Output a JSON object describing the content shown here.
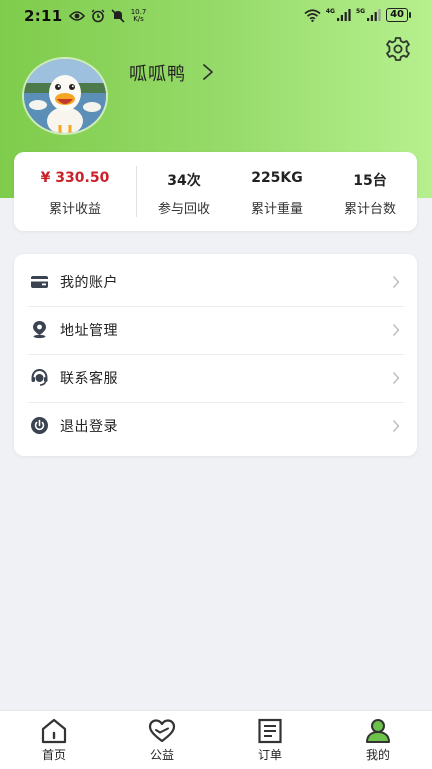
{
  "status_bar": {
    "time": "2:11",
    "speed_value": "10.7",
    "speed_unit": "K/s",
    "net_label": "4G",
    "net_label_2": "5G",
    "battery": "40"
  },
  "profile": {
    "name": "呱呱鸭"
  },
  "stats": [
    {
      "value": "¥ 330.50",
      "label": "累计收益"
    },
    {
      "value": "34次",
      "label": "参与回收"
    },
    {
      "value": "225KG",
      "label": "累计重量"
    },
    {
      "value": "15台",
      "label": "累计台数"
    }
  ],
  "menu": [
    {
      "label": "我的账户",
      "icon": "wallet-icon"
    },
    {
      "label": "地址管理",
      "icon": "location-pin-icon"
    },
    {
      "label": "联系客服",
      "icon": "headset-icon"
    },
    {
      "label": "退出登录",
      "icon": "power-icon"
    }
  ],
  "tabs": [
    {
      "label": "首页",
      "icon": "home-icon"
    },
    {
      "label": "公益",
      "icon": "heart-icon"
    },
    {
      "label": "订单",
      "icon": "order-list-icon"
    },
    {
      "label": "我的",
      "icon": "user-icon",
      "active": true
    }
  ],
  "colors": {
    "header_green": "#8dd55f",
    "earnings_red": "#c9222a",
    "icon_dark": "#3b4250",
    "active_tab_green": "#6cc24a"
  }
}
